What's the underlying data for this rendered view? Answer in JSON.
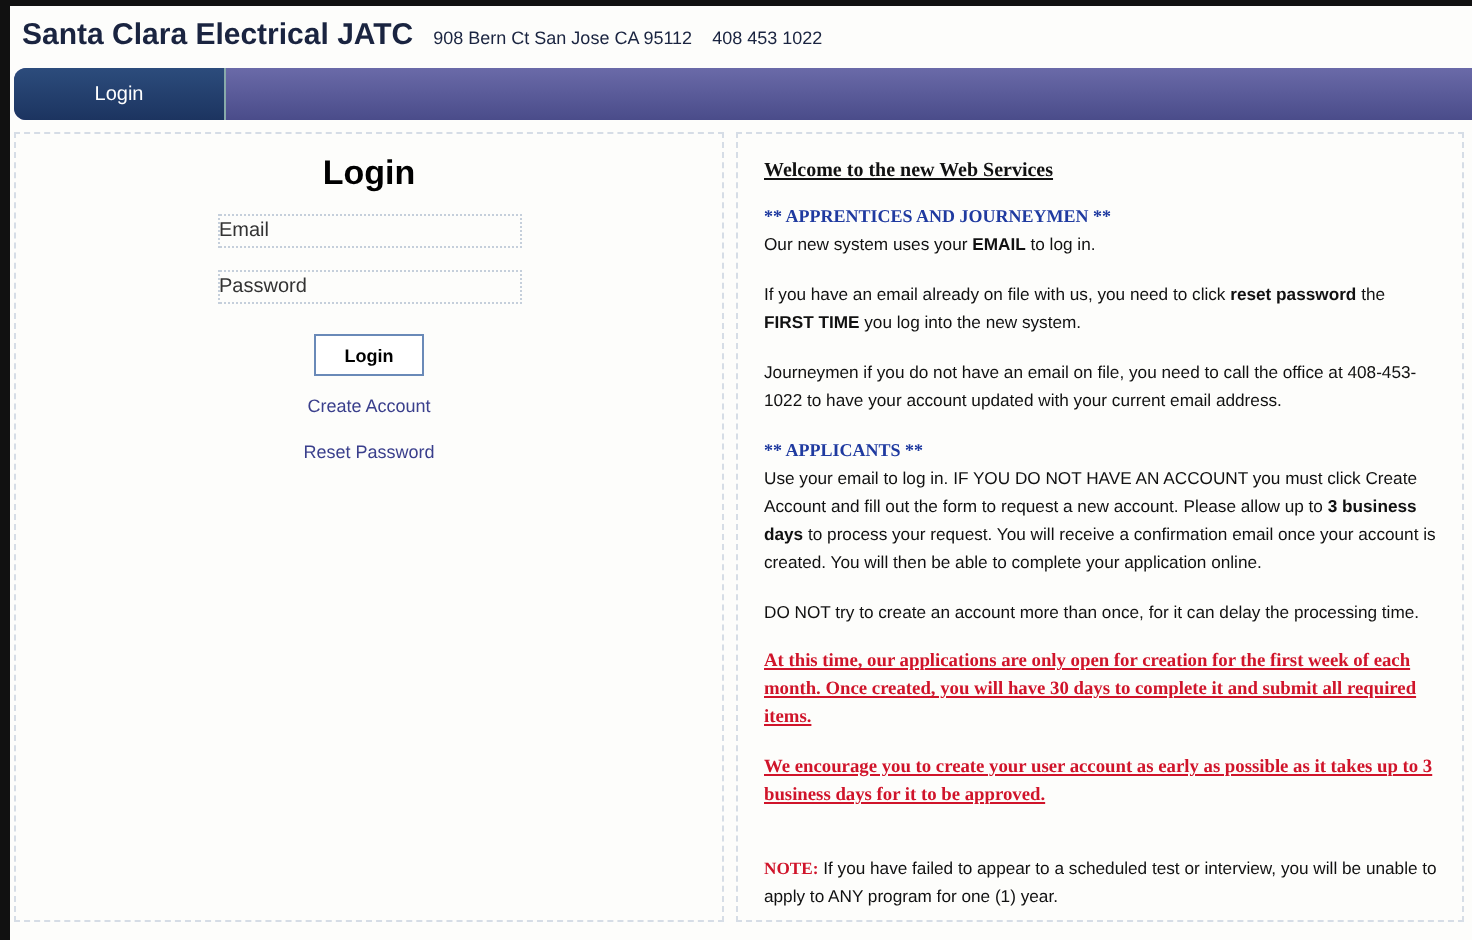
{
  "header": {
    "title": "Santa Clara Electrical JATC",
    "address": "908 Bern Ct San Jose CA 95112",
    "phone": "408 453 1022"
  },
  "nav": [
    {
      "label": "Login",
      "selected": true
    }
  ],
  "login": {
    "title": "Login",
    "fields": [
      {
        "placeholder": "Email"
      },
      {
        "placeholder": "Password"
      }
    ],
    "button": "Login",
    "links": [
      "Create Account",
      "Reset Password"
    ]
  },
  "info": {
    "title": "Welcome to the new Web Services",
    "blocks": [
      {
        "kind": "heading",
        "text": "** APPRENTICES AND JOURNEYMEN **"
      },
      {
        "kind": "text",
        "text": "Our new system uses your **EMAIL** to log in."
      },
      {
        "kind": "text",
        "text": "If you have an email already on file with us, you need to click **reset password** the **FIRST TIME** you log into the new system."
      },
      {
        "kind": "text",
        "text": "Journeymen if you do not have an email on file, you need to call the office at 408-453-1022 to have your account updated with your current email address."
      },
      {
        "kind": "heading",
        "text": "** APPLICANTS **"
      },
      {
        "kind": "text",
        "text": "Use your email to log in. IF YOU DO NOT HAVE AN ACCOUNT you must click Create Account and fill out the form to request a new account. Please allow up to **3 business days** to process your request. You will receive a confirmation email once your account is created. You will then be able to complete your application online."
      },
      {
        "kind": "text",
        "text": "DO NOT try to create an account more than once, for it can delay the processing time."
      },
      {
        "kind": "alert",
        "text": "At this time, our applications are only open for creation for the first week of each month. Once created, you will have 30 days to complete it and submit all required items."
      },
      {
        "kind": "alert",
        "text": "We encourage you to create your user account as early as possible as it takes up to 3 business days for it to be approved."
      },
      {
        "kind": "note",
        "label": "NOTE:",
        "text": "If you have failed to appear to a scheduled test or interview, you will be unable to apply to ANY program for one (1) year."
      }
    ]
  }
}
